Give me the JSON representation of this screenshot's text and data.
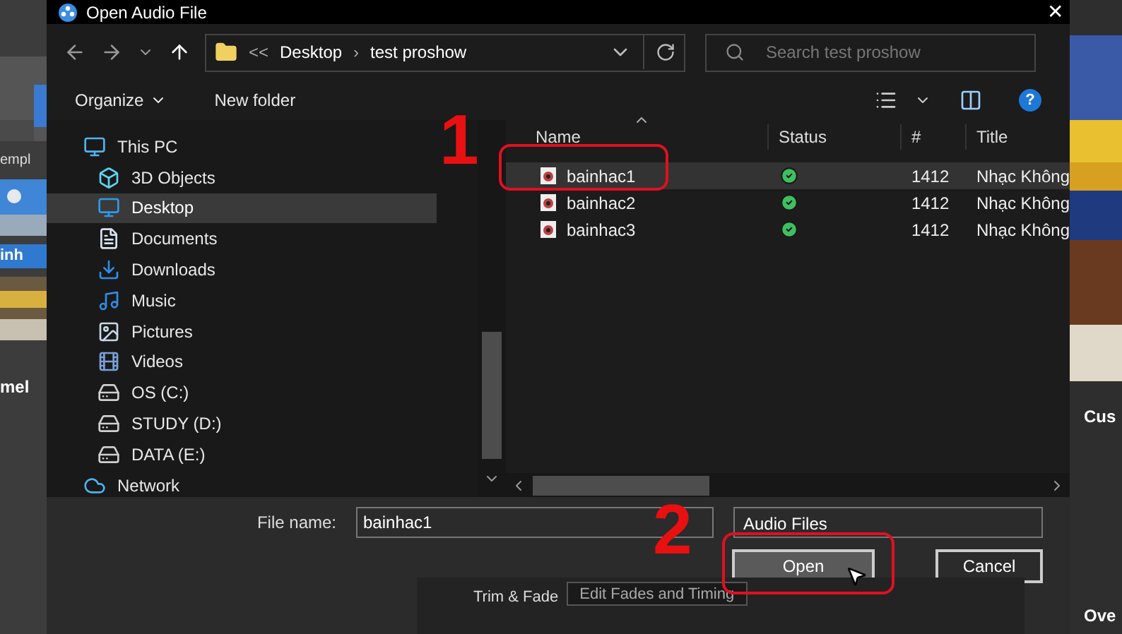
{
  "background_app": {
    "left_labels": [
      "empl",
      "inh",
      "mel"
    ],
    "right_labels": [
      "Cus",
      "Ove"
    ],
    "trim_label": "Trim & Fade",
    "edit_button": "Edit Fades and Timing"
  },
  "window": {
    "title": "Open Audio File",
    "close": "✕"
  },
  "address": {
    "overflow": "<<",
    "segments": [
      "Desktop",
      "test proshow"
    ],
    "separator": "›"
  },
  "search": {
    "placeholder": "Search test proshow"
  },
  "toolbar": {
    "organize": "Organize",
    "new_folder": "New folder",
    "help": "?"
  },
  "sidebar": {
    "items": [
      {
        "label": "This PC",
        "kind": "pc",
        "selected": false,
        "children": [
          {
            "label": "3D Objects",
            "kind": "cube",
            "selected": false
          },
          {
            "label": "Desktop",
            "kind": "desktop",
            "selected": true
          },
          {
            "label": "Documents",
            "kind": "doc",
            "selected": false
          },
          {
            "label": "Downloads",
            "kind": "download",
            "selected": false
          },
          {
            "label": "Music",
            "kind": "music",
            "selected": false
          },
          {
            "label": "Pictures",
            "kind": "pictures",
            "selected": false
          },
          {
            "label": "Videos",
            "kind": "videos",
            "selected": false
          },
          {
            "label": "OS (C:)",
            "kind": "drive",
            "selected": false
          },
          {
            "label": "STUDY (D:)",
            "kind": "drive",
            "selected": false
          },
          {
            "label": "DATA (E:)",
            "kind": "drive",
            "selected": false
          }
        ]
      },
      {
        "label": "Network",
        "kind": "network",
        "selected": false
      }
    ]
  },
  "table": {
    "columns": [
      "Name",
      "Status",
      "#",
      "Title"
    ],
    "rows": [
      {
        "name": "bainhac1",
        "number": "1412",
        "title": "Nhạc Không",
        "selected": true
      },
      {
        "name": "bainhac2",
        "number": "1412",
        "title": "Nhạc Không",
        "selected": false
      },
      {
        "name": "bainhac3",
        "number": "1412",
        "title": "Nhạc Không",
        "selected": false
      }
    ]
  },
  "footer": {
    "file_name_label": "File name:",
    "file_name": "bainhac1",
    "filter": "Audio Files",
    "open": "Open",
    "cancel": "Cancel"
  },
  "annotations": [
    "1",
    "2"
  ]
}
